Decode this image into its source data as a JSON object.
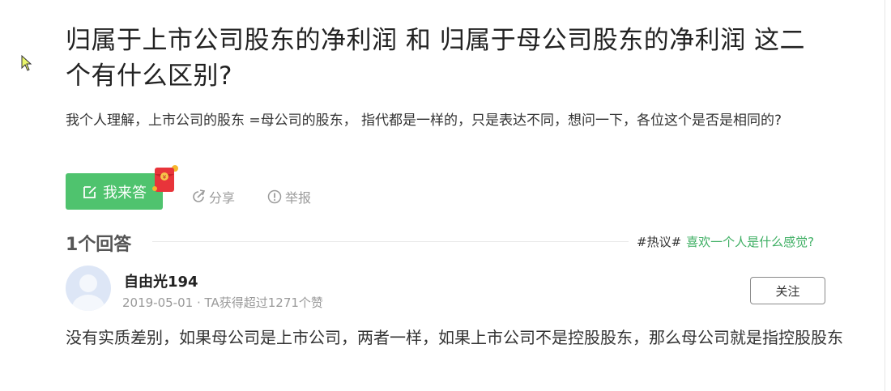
{
  "question": {
    "title": "归属于上市公司股东的净利润 和 归属于母公司股东的净利润 这二个有什么区别?",
    "description": "我个人理解，上市公司的股东 =母公司的股东， 指代都是一样的，只是表达不同，想问一下，各位这个是否是相同的?"
  },
  "actions": {
    "answer_label": "我来答",
    "share_label": "分享",
    "report_label": "举报"
  },
  "answers_header": {
    "count_label": "1个回答",
    "hot_tag": "#热议#",
    "hot_link": "喜欢一个人是什么感觉?"
  },
  "answer": {
    "user_name": "自由光194",
    "meta": "2019-05-01 · TA获得超过1271个赞",
    "follow_label": "关注",
    "content": "没有实质差别，如果母公司是上市公司，两者一样，如果上市公司不是控股股东，那么母公司就是指控股股东"
  },
  "colors": {
    "accent_green": "#4fc36e",
    "link_green": "#3eaf63",
    "muted_gray": "#9b9b9b"
  }
}
